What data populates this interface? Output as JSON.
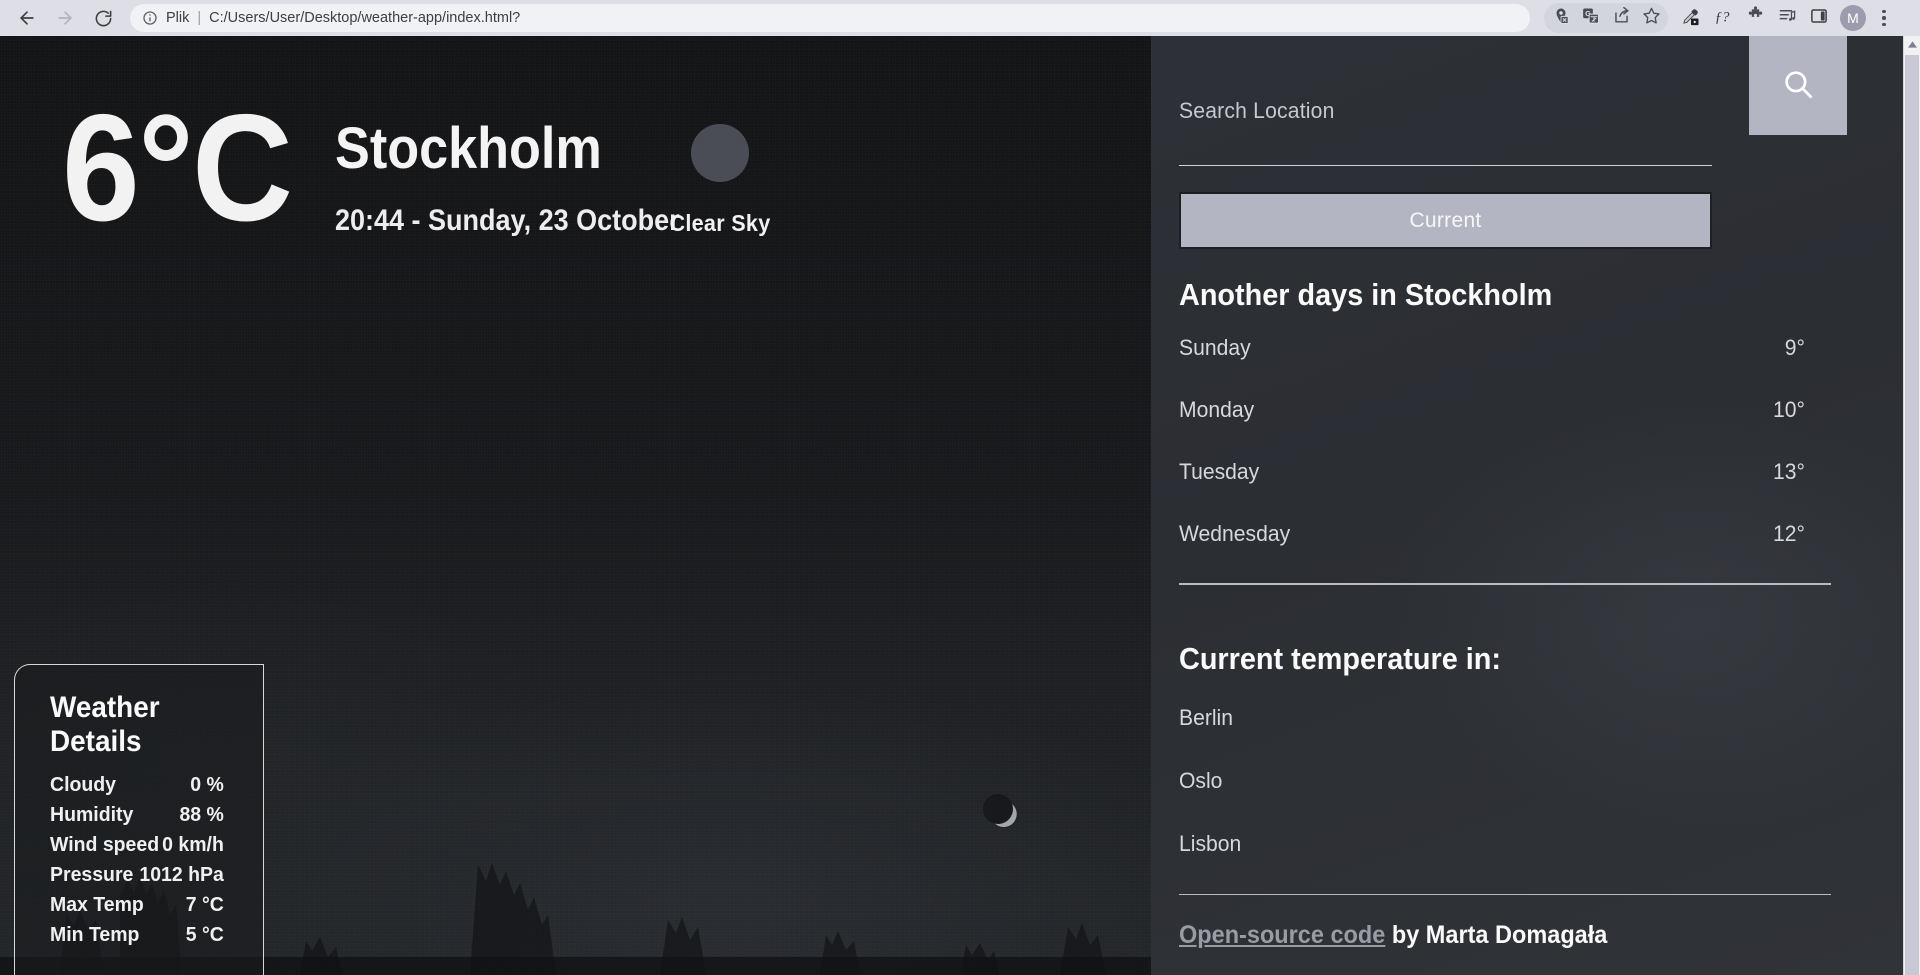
{
  "browser": {
    "back_icon": "back-arrow-icon",
    "forward_icon": "forward-arrow-icon",
    "reload_icon": "reload-icon",
    "info_icon": "info-circle-icon",
    "url_scheme_label": "Plik",
    "url_separator": "|",
    "url": "C:/Users/User/Desktop/weather-app/index.html?",
    "toolbar_icons": [
      "location-blocked-icon",
      "translate-icon",
      "share-icon",
      "bookmark-star-icon",
      "eyedropper-icon",
      "font-question-icon",
      "extensions-puzzle-icon",
      "reading-list-music-icon",
      "side-panel-icon"
    ],
    "avatar_initial": "M",
    "menu_icon": "three-dot-menu-icon"
  },
  "hero": {
    "temperature": "6°C",
    "city": "Stockholm",
    "datetime": "20:44 - Sunday, 23 October",
    "condition_icon": "weather-condition-icon",
    "condition_label": "Clear Sky",
    "moon_icon": "crescent-moon-icon"
  },
  "details": {
    "title": "Weather Details",
    "rows": [
      {
        "label": "Cloudy",
        "value": "0 %"
      },
      {
        "label": "Humidity",
        "value": "88 %"
      },
      {
        "label": "Wind speed",
        "value": "0 km/h"
      },
      {
        "label": "Pressure",
        "value": "1012 hPa"
      },
      {
        "label": "Max Temp",
        "value": "7 °C"
      },
      {
        "label": "Min Temp",
        "value": "5 °C"
      }
    ]
  },
  "sidebar": {
    "search_label": "Search Location",
    "search_value": "",
    "search_placeholder": "",
    "search_icon": "search-magnifier-icon",
    "current_button": "Current",
    "forecast_title": "Another days in Stockholm",
    "forecast": [
      {
        "day": "Sunday",
        "temp": "9°"
      },
      {
        "day": "Monday",
        "temp": "10°"
      },
      {
        "day": "Tuesday",
        "temp": "13°"
      },
      {
        "day": "Wednesday",
        "temp": "12°"
      }
    ],
    "cities_title": "Current temperature in:",
    "cities": [
      {
        "name": "Berlin",
        "temp": ""
      },
      {
        "name": "Oslo",
        "temp": ""
      },
      {
        "name": "Lisbon",
        "temp": ""
      }
    ],
    "footer_link": "Open-source code",
    "footer_rest": " by Marta Domagała"
  },
  "colors": {
    "accent_button": "#b3b5c3",
    "sidebar_bg": "#2b2e33",
    "hero_bg": "#16171a",
    "text_primary": "#fafafa",
    "text_secondary": "#d6d8de"
  }
}
